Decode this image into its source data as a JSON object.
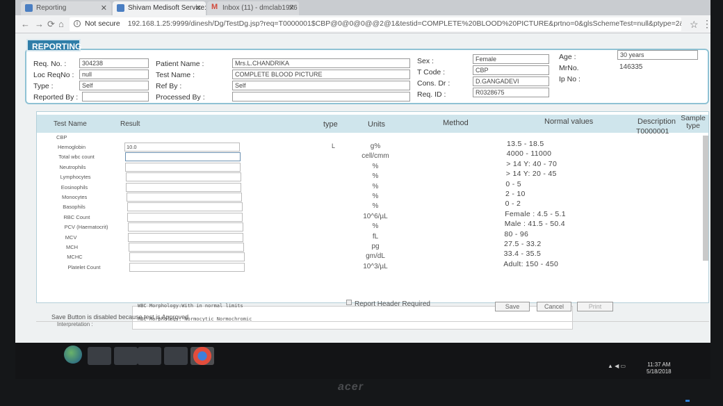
{
  "browser": {
    "tabs": [
      {
        "label": "Reporting",
        "color": "#4a7ec2",
        "active": false
      },
      {
        "label": "Shivam Medisoft Service:",
        "color": "#4a7ec2",
        "active": true
      },
      {
        "label": "Inbox (11) - dmclab1976",
        "color": "#d24a3c",
        "active": false
      }
    ],
    "security": "Not secure",
    "url": "192.168.1.25:9999/dinesh/Dg/TestDg.jsp?req=T0000001$CBP@0@0@0@@2@1&testid=COMPLETE%20BLOOD%20PICTURE&prtno=0&glsSchemeTest=null&ptype=2&ty..."
  },
  "app": {
    "section_title": "REPORTING",
    "header": {
      "req_no_label": "Req. No. :",
      "req_no": "304238",
      "loc_reqno_label": "Loc ReqNo :",
      "loc_reqno": "null",
      "type_label": "Type :",
      "type": "Self",
      "reported_by_label": "Reported By :",
      "reported_by": "",
      "patient_name_label": "Patient Name :",
      "patient_name": "Mrs.L.CHANDRIKA",
      "test_name_label": "Test Name :",
      "test_name": "COMPLETE BLOOD PICTURE",
      "ref_by_label": "Ref By :",
      "ref_by": "Self",
      "processed_by_label": "Processed By :",
      "processed_by": "",
      "sex_label": "Sex :",
      "sex": "Female",
      "t_code_label": "T Code :",
      "t_code": "CBP",
      "cons_dr_label": "Cons. Dr :",
      "cons_dr": "D.GANGADEVI",
      "req_id_label": "Req. ID :",
      "req_id": "R0328675",
      "age_label": "Age :",
      "age": "30 years",
      "mrno_label": "MrNo.",
      "mrno": "146335",
      "ip_no_label": "Ip No :"
    },
    "columns": {
      "test_name": "Test Name",
      "result": "Result",
      "type": "type",
      "units": "Units",
      "method": "Method",
      "normal_values": "Normal values",
      "description": "Description",
      "sample_type": "Sample type"
    },
    "group_name": "CBP",
    "description_value": "T0000001",
    "tests": [
      {
        "name": "Hemoglobin",
        "result": "10.0",
        "type": "L",
        "unit": "g%",
        "normal": "13.5 - 18.5"
      },
      {
        "name": "Total wbc count",
        "result": "",
        "type": "",
        "unit": "cell/cmm",
        "normal": "4000 - 11000"
      },
      {
        "name": "Neutrophils",
        "result": "",
        "type": "",
        "unit": "%",
        "normal": "> 14 Y: 40 - 70"
      },
      {
        "name": "Lymphocytes",
        "result": "",
        "type": "",
        "unit": "%",
        "normal": "> 14 Y: 20 - 45"
      },
      {
        "name": "Eosinophils",
        "result": "",
        "type": "",
        "unit": "%",
        "normal": "0 - 5"
      },
      {
        "name": "Monocytes",
        "result": "",
        "type": "",
        "unit": "%",
        "normal": "2 - 10"
      },
      {
        "name": "Basophils",
        "result": "",
        "type": "",
        "unit": "%",
        "normal": "0 - 2"
      },
      {
        "name": "RBC Count",
        "result": "",
        "type": "",
        "unit": "10^6/µL",
        "normal": "Female : 4.5 - 5.1"
      },
      {
        "name": "PCV (Haematocrit)",
        "result": "",
        "type": "",
        "unit": "%",
        "normal": "Male : 41.5 - 50.4"
      },
      {
        "name": "MCV",
        "result": "",
        "type": "",
        "unit": "fL",
        "normal": "80 - 96"
      },
      {
        "name": "MCH",
        "result": "",
        "type": "",
        "unit": "pg",
        "normal": "27.5 - 33.2"
      },
      {
        "name": "MCHC",
        "result": "",
        "type": "",
        "unit": "gm/dL",
        "normal": "33.4 - 35.5"
      },
      {
        "name": "Platelet Count",
        "result": "",
        "type": "",
        "unit": "10^3/µL",
        "normal": "Adult: 150 - 450"
      }
    ],
    "wbc_morphology": "WBC Morphology:With in normal limits",
    "rbc_morphology": "RBC Morphology: Normocytic Normochromic",
    "interpretation_label": "Interpretation :",
    "report_header_label": "Report Header Required",
    "buttons": {
      "save": "Save",
      "cancel": "Cancel",
      "print": "Print"
    },
    "status_message": "Save Button is disabled because test is Approved"
  },
  "taskbar": {
    "time": "11:37 AM",
    "date": "5/18/2018"
  },
  "monitor_brand": "acer",
  "colors": {
    "accent": "#2f7da8",
    "header_border": "#8fc2d4",
    "column_header_bg": "#cfe5ec"
  }
}
